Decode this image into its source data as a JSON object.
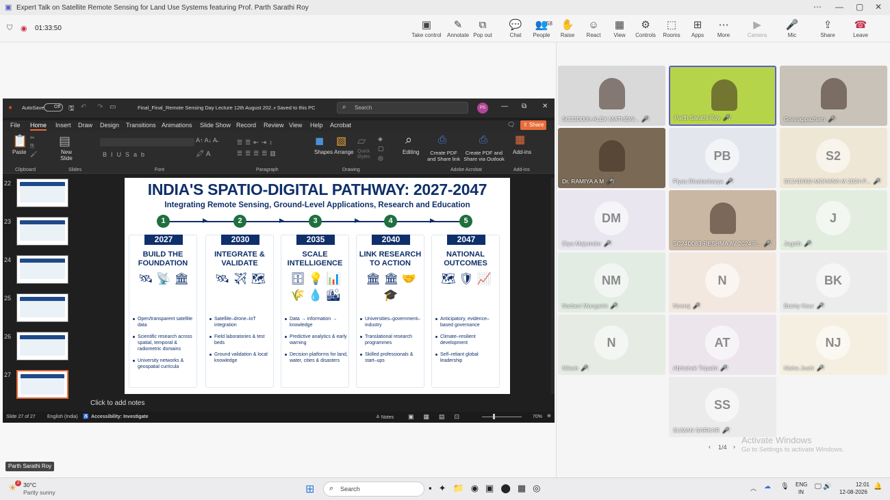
{
  "window": {
    "title": "Expert Talk on Satellite Remote Sensing for Land Use Systems featuring Prof. Parth Sarathi Roy",
    "timer": "01:33:50"
  },
  "toolbar": [
    {
      "label": "Take control",
      "icon": "take-control-icon",
      "glyph": "▣"
    },
    {
      "label": "Annotate",
      "icon": "annotate-icon",
      "glyph": "✎"
    },
    {
      "label": "Pop out",
      "icon": "pop-out-icon",
      "glyph": "⧉"
    },
    {
      "label": "Chat",
      "icon": "chat-icon",
      "glyph": "💬"
    },
    {
      "label": "People",
      "icon": "people-icon",
      "glyph": "👥",
      "count": "58"
    },
    {
      "label": "Raise",
      "icon": "raise-hand-icon",
      "glyph": "✋"
    },
    {
      "label": "React",
      "icon": "react-icon",
      "glyph": "☺"
    },
    {
      "label": "View",
      "icon": "view-icon",
      "glyph": "▦"
    },
    {
      "label": "Controls",
      "icon": "controls-icon",
      "glyph": "⚙"
    },
    {
      "label": "Rooms",
      "icon": "rooms-icon",
      "glyph": "⬚"
    },
    {
      "label": "Apps",
      "icon": "apps-icon",
      "glyph": "⊞"
    },
    {
      "label": "More",
      "icon": "more-icon",
      "glyph": "⋯"
    },
    {
      "label": "Camera",
      "icon": "camera-icon",
      "glyph": "▶"
    },
    {
      "label": "Mic",
      "icon": "mic-icon",
      "glyph": "🎤"
    },
    {
      "label": "Share",
      "icon": "share-icon",
      "glyph": "⇪"
    },
    {
      "label": "Leave",
      "icon": "leave-icon",
      "glyph": "☎"
    }
  ],
  "ppt": {
    "autosave": "AutoSave",
    "off": "Off",
    "filename": "Final_Final_Remote Sensing Day Lecture 12th August 202...",
    "saved": "• Saved to this PC",
    "search": "Search",
    "avatar": "PS",
    "menu": [
      "File",
      "Home",
      "Insert",
      "Draw",
      "Design",
      "Transitions",
      "Animations",
      "Slide Show",
      "Record",
      "Review",
      "View",
      "Help",
      "Acrobat"
    ],
    "share": "Share",
    "ribbon": {
      "paste": "Paste",
      "new_slide": "New Slide",
      "clipboard": "Clipboard",
      "slides": "Slides",
      "font": "Font",
      "paragraph": "Paragraph",
      "shapes": "Shapes",
      "arrange": "Arrange",
      "quick_styles": "Quick Styles",
      "drawing": "Drawing",
      "editing": "Editing",
      "create_pdf": "Create PDF and Share link",
      "create_pdf2": "Create PDF and Share via Outlook",
      "adobe": "Adobe Acrobat",
      "addins": "Add-ins",
      "addins_group": "Add-ins"
    },
    "thumbs": [
      "22",
      "23",
      "24",
      "25",
      "26",
      "27"
    ],
    "notes": "Click to add notes",
    "status": {
      "slide": "Slide 27 of 27",
      "lang": "English (India)",
      "access": "Accessibility: Investigate",
      "notes": "Notes",
      "zoom": "70%"
    }
  },
  "slide": {
    "title": "INDIA'S SPATIO-DIGITAL PATHWAY: 2027-2047",
    "subtitle": "Integrating Remote Sensing, Ground-Level Applications, Research and Education",
    "cols": [
      {
        "n": "1",
        "year": "2027",
        "head": "BUILD THE FOUNDATION",
        "icons": "🛰 📡 🏛",
        "bullets": [
          "Open/transparent satellite data",
          "Scientific research across spatial, temporal & radiometric domains",
          "University networks & geospatial curricula"
        ]
      },
      {
        "n": "2",
        "year": "2030",
        "head": "INTEGRATE & VALIDATE",
        "icons": "🛰 ✈ 🗺",
        "bullets": [
          "Satellite–drone–IoT integration",
          "Field laboratories & test beds",
          "Ground validation & local knowledge"
        ]
      },
      {
        "n": "3",
        "year": "2035",
        "head": "SCALE INTELLIGENCE",
        "icons": "🗄 💡 📊 🌾 💧 🏙",
        "bullets": [
          "Data → information → knowledge",
          "Predictive analytics & early warning",
          "Decision platforms for land, water, cities & disasters"
        ]
      },
      {
        "n": "4",
        "year": "2040",
        "head": "LINK RESEARCH TO ACTION",
        "icons": "🏛 🏛 🤝 🎓",
        "bullets": [
          "Universities–government–industry",
          "Translational research programmes",
          "Skilled professionals & start–ups"
        ]
      },
      {
        "n": "5",
        "year": "2047",
        "head": "NATIONAL OUTCOMES",
        "icons": "🗺 🛡 📈",
        "bullets": [
          "Anticipatory, evidence–based governance",
          "Climate–resilient development",
          "Self–reliant global leadership"
        ]
      }
    ]
  },
  "presenter": "Parth Sarathi Roy",
  "participants": [
    {
      "name": "SC23D006-ALEX MATHEW...",
      "initials": "",
      "bg": "#d9d9d9"
    },
    {
      "name": "Parth Sarathi Roy",
      "initials": "",
      "bg": "#b6d44a"
    },
    {
      "name": "Gnanappazham",
      "initials": "",
      "bg": "#c8c2b8"
    },
    {
      "name": "Dr. RAMIYA A M",
      "initials": "",
      "bg": "#7a6a55"
    },
    {
      "name": "Piyas Bhattacharya",
      "initials": "PB",
      "bg": "#e4e6ee"
    },
    {
      "name": "SC24D082-MOHANA M 2024-P...",
      "initials": "S2",
      "bg": "#efe7d5"
    },
    {
      "name": "Diya Majumder",
      "initials": "DM",
      "bg": "#e9e6ef"
    },
    {
      "name": "SC24D083-RESHMA AV 2024-P...",
      "initials": "",
      "bg": "#c9b7a4"
    },
    {
      "name": "Jagath",
      "initials": "J",
      "bg": "#e3eddf"
    },
    {
      "name": "Norbert Mungwini",
      "initials": "NM",
      "bg": "#e2ece3"
    },
    {
      "name": "Neeraj",
      "initials": "N",
      "bg": "#f3e8e0"
    },
    {
      "name": "Bainty Kaur",
      "initials": "BK",
      "bg": "#ececec"
    },
    {
      "name": "Nilesh",
      "initials": "N",
      "bg": "#e6ebe4"
    },
    {
      "name": "Abhishek Tripathi",
      "initials": "AT",
      "bg": "#ece6ec"
    },
    {
      "name": "Nisha Joshi",
      "initials": "NJ",
      "bg": "#f4efe0"
    },
    {
      "name": "SUMAN SARKAR",
      "initials": "SS",
      "bg": "#ebebeb"
    }
  ],
  "pager": "1/4",
  "watermark": {
    "line1": "Activate Windows",
    "line2": "Go to Settings to activate Windows."
  },
  "taskbar": {
    "temp": "30°C",
    "weather": "Partly sunny",
    "badge": "2",
    "search": "Search",
    "lang1": "ENG",
    "lang2": "IN",
    "time": "12:01",
    "date": "12-08-2026"
  }
}
